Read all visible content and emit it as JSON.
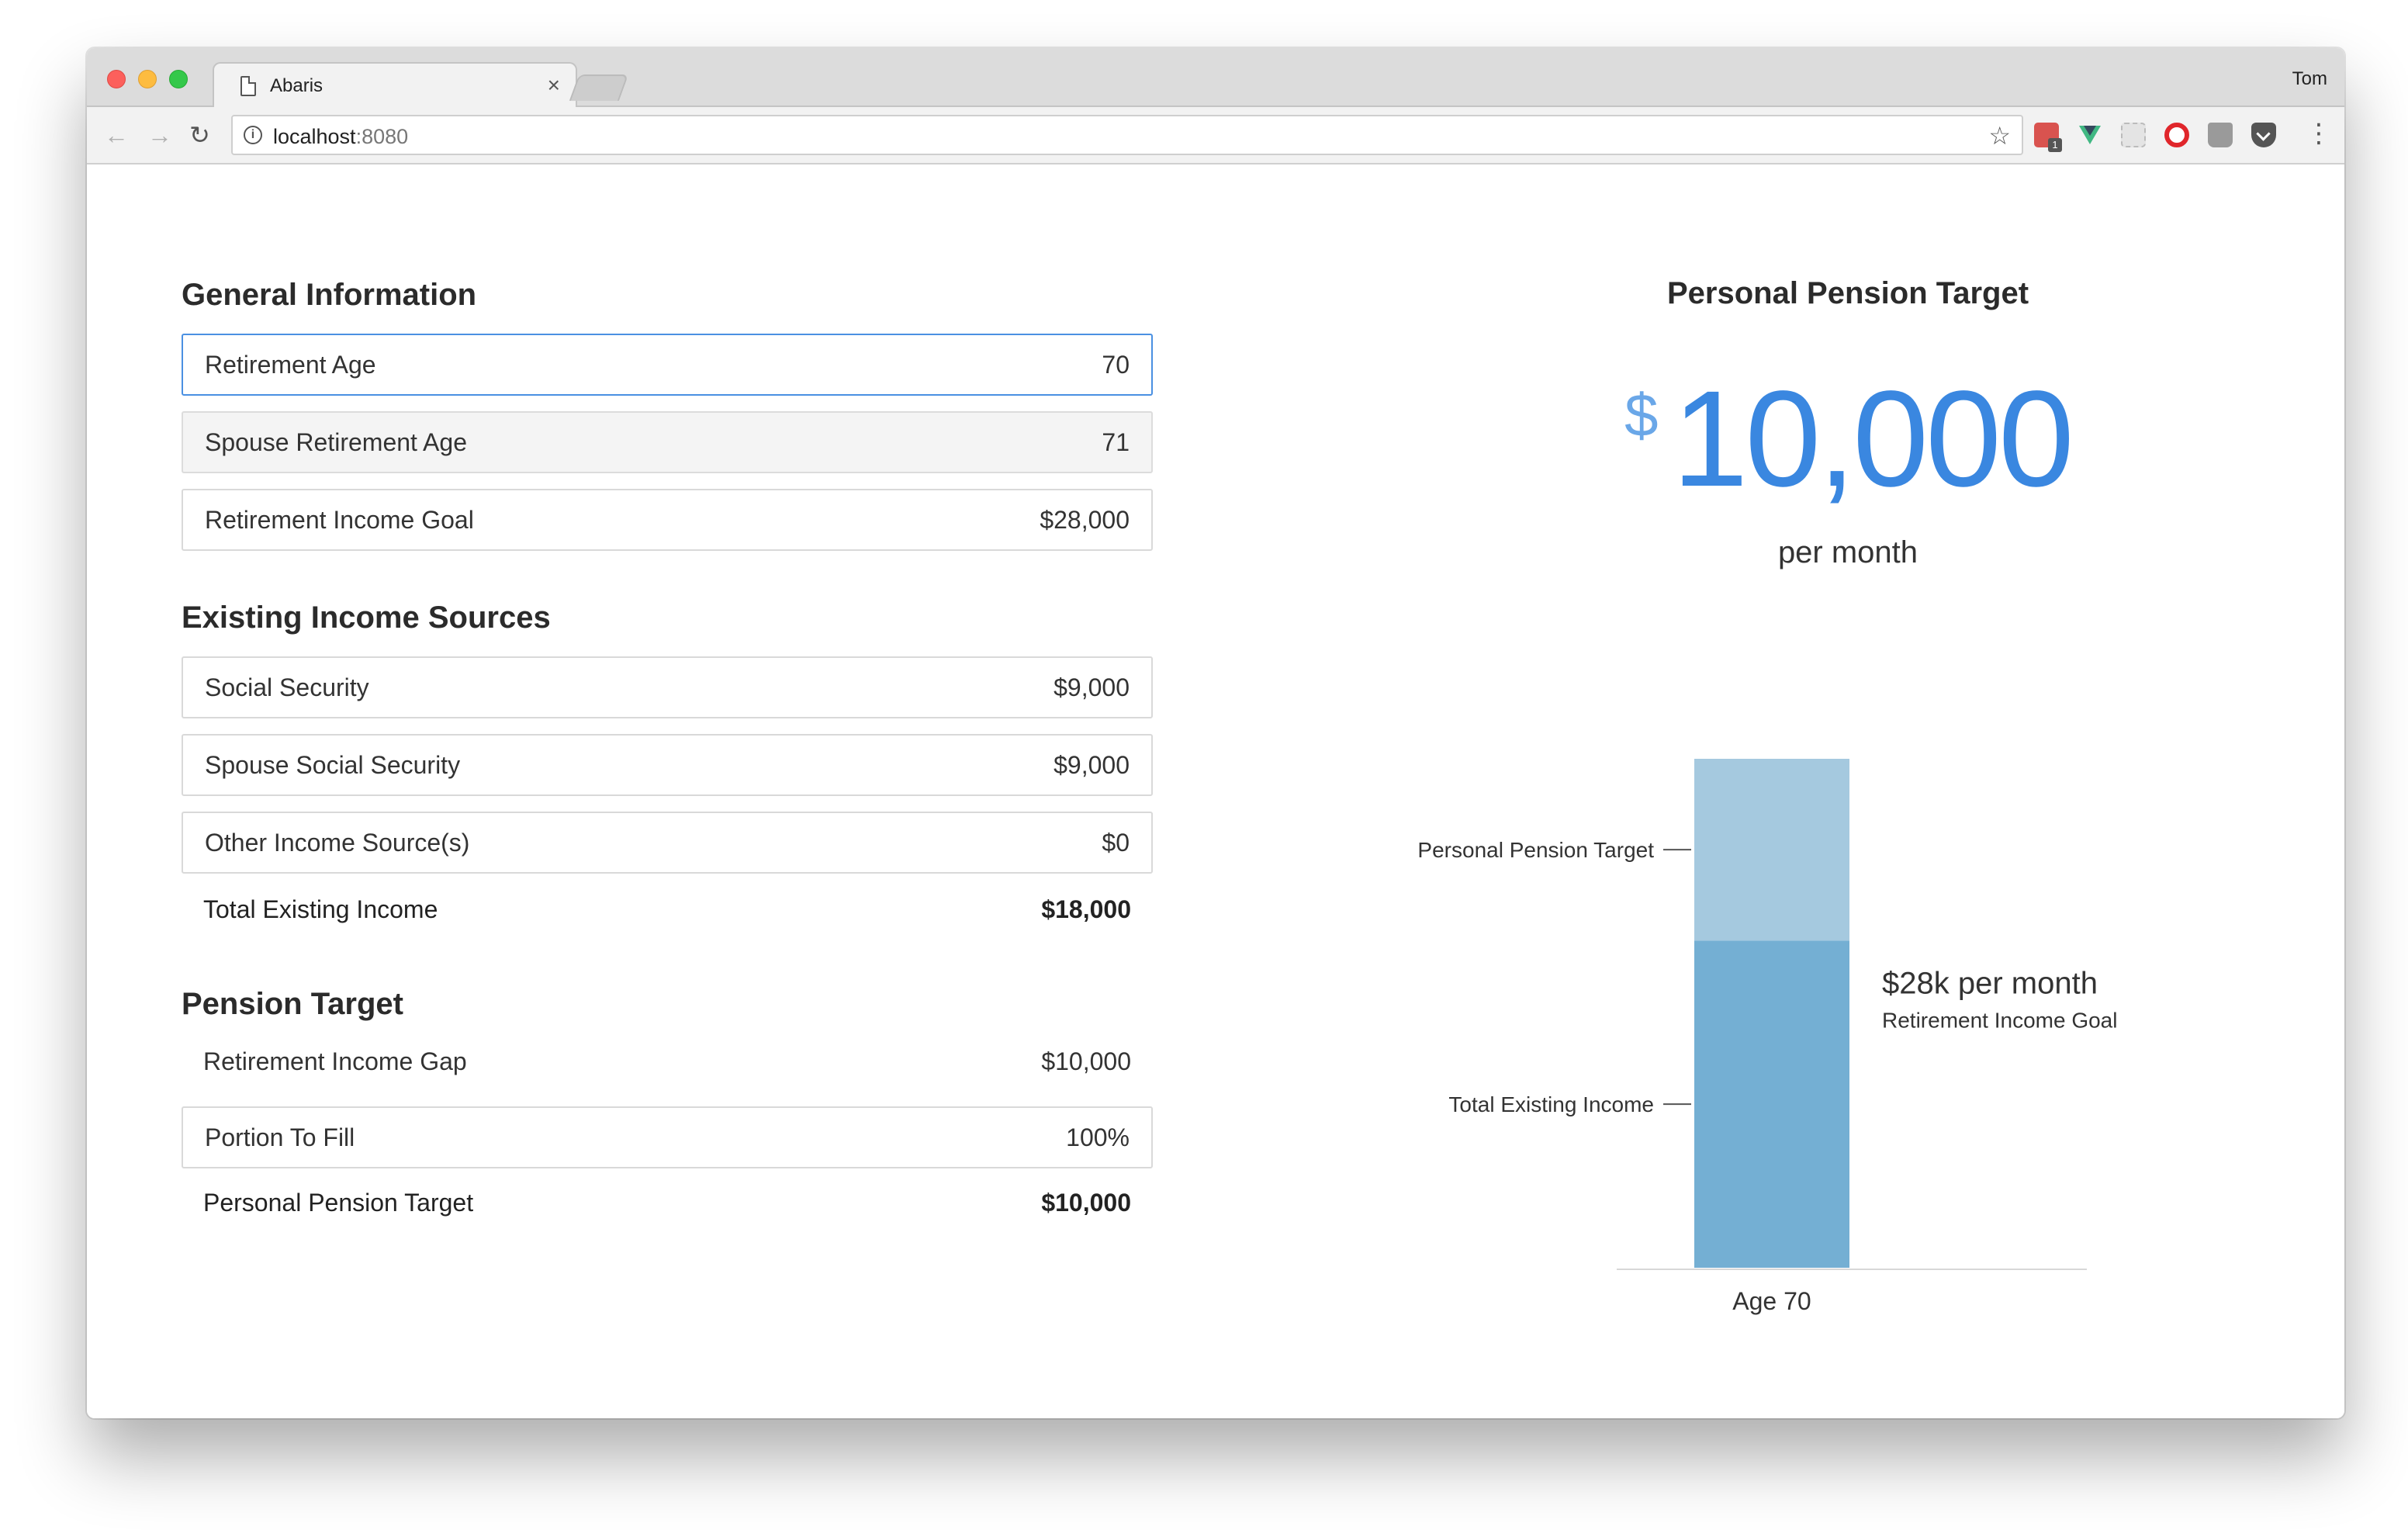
{
  "browser": {
    "tab_title": "Abaris",
    "tab_close": "×",
    "profile": "Tom",
    "url_host": "localhost",
    "url_port": ":8080",
    "nav_back": "←",
    "nav_forward": "→",
    "nav_reload": "↻",
    "bookmark_star": "☆",
    "menu": "⋮",
    "extension_badge": "1"
  },
  "general": {
    "title": "General Information",
    "fields": [
      {
        "label": "Retirement Age",
        "value": "70"
      },
      {
        "label": "Spouse Retirement Age",
        "value": "71"
      },
      {
        "label": "Retirement Income Goal",
        "value": "$28,000"
      }
    ]
  },
  "income": {
    "title": "Existing Income Sources",
    "fields": [
      {
        "label": "Social Security",
        "value": "$9,000"
      },
      {
        "label": "Spouse Social Security",
        "value": "$9,000"
      },
      {
        "label": "Other Income Source(s)",
        "value": "$0"
      }
    ],
    "total": {
      "label": "Total Existing Income",
      "value": "$18,000"
    }
  },
  "pension": {
    "title": "Pension Target",
    "gap": {
      "label": "Retirement Income Gap",
      "value": "$10,000"
    },
    "portion": {
      "label": "Portion To Fill",
      "value": "100%"
    },
    "target": {
      "label": "Personal Pension Target",
      "value": "$10,000"
    }
  },
  "summary": {
    "title": "Personal Pension Target",
    "currency": "$",
    "amount": "10,000",
    "period": "per month"
  },
  "colors": {
    "accent": "#3a87e0",
    "bar_existing": "#74afd3",
    "bar_target": "#a5c9df"
  },
  "chart_data": {
    "type": "bar",
    "stacked": true,
    "categories": [
      "Age 70"
    ],
    "series": [
      {
        "name": "Total Existing Income",
        "values": [
          18000
        ]
      },
      {
        "name": "Personal Pension Target",
        "values": [
          10000
        ]
      }
    ],
    "annotation": {
      "headline": "$28k per month",
      "subtext": "Retirement Income Goal"
    },
    "ylim": [
      0,
      28000
    ],
    "grid": false
  }
}
